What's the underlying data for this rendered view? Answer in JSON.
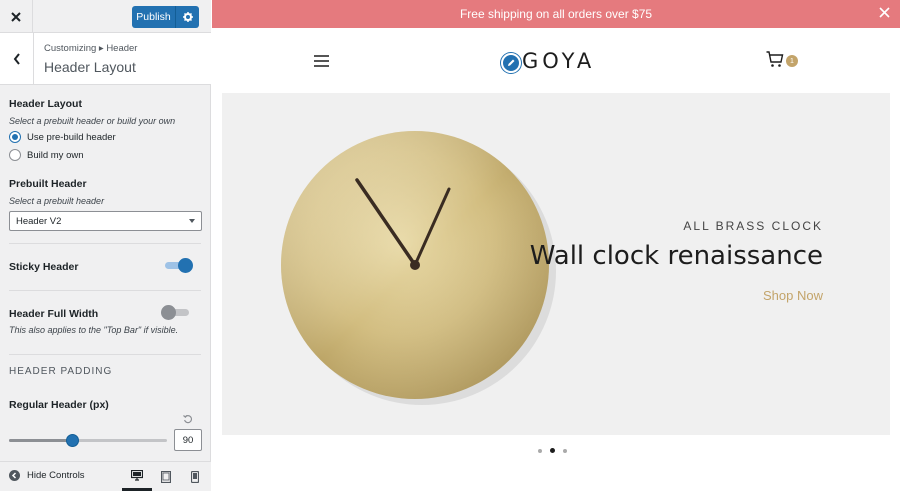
{
  "customizer": {
    "publish_label": "Publish",
    "breadcrumb": "Customizing ▸ Header",
    "section_title": "Header Layout",
    "header_layout": {
      "title": "Header Layout",
      "description": "Select a prebuilt header or build your own",
      "options": [
        {
          "label": "Use pre-build header",
          "checked": true
        },
        {
          "label": "Build my own",
          "checked": false
        }
      ]
    },
    "prebuilt_header": {
      "title": "Prebuilt Header",
      "description": "Select a prebuilt header",
      "selected": "Header V2"
    },
    "sticky_header": {
      "label": "Sticky Header",
      "enabled": true
    },
    "full_width": {
      "label": "Header Full Width",
      "description": "This also applies to the \"Top Bar\" if visible.",
      "enabled": false
    },
    "padding_heading": "HEADER PADDING",
    "regular_header": {
      "label": "Regular Header (px)",
      "value": "90",
      "fraction": 0.4
    },
    "hide_controls_label": "Hide Controls",
    "devices": [
      "desktop-icon",
      "tablet-icon",
      "mobile-icon"
    ]
  },
  "preview": {
    "topbar_text": "Free shipping on all orders over $75",
    "logo_text": "GOYA",
    "cart_count": "1",
    "hero": {
      "eyebrow": "ALL BRASS CLOCK",
      "title": "Wall clock renaissance",
      "cta": "Shop Now"
    },
    "slides": 3,
    "active_slide": 2
  },
  "colors": {
    "accent": "#2271b1",
    "topbar": "#e57a7e",
    "gold": "#c3a46a"
  }
}
